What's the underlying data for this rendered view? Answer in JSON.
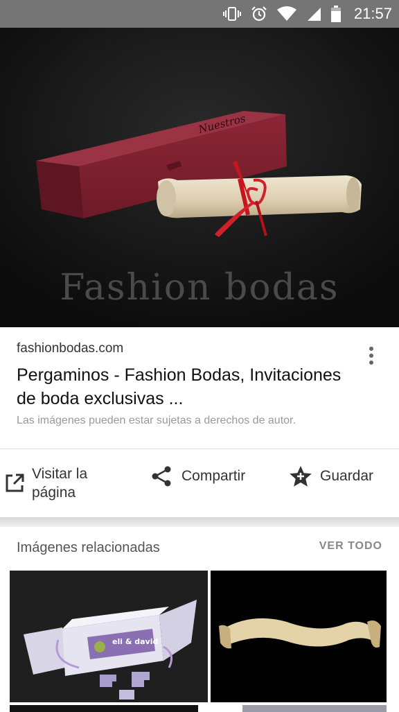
{
  "status_bar": {
    "time": "21:57",
    "icons": [
      "vibrate-icon",
      "alarm-icon",
      "wifi-icon",
      "signal-icon",
      "battery-icon"
    ]
  },
  "hero_image": {
    "watermark": "Fashion bodas",
    "box_script": "Nuestros"
  },
  "result": {
    "domain": "fashionbodas.com",
    "title": "Pergaminos - Fashion Bodas, Invitaciones de boda exclusivas ...",
    "copyright_notice": "Las imágenes pueden estar sujetas a derechos de autor."
  },
  "actions": {
    "visit_label": "Visitar la página",
    "share_label": "Compartir",
    "save_label": "Guardar"
  },
  "related": {
    "heading": "Imágenes relacionadas",
    "see_all": "VER TODO",
    "thumb1_text": "eli & david"
  },
  "colors": {
    "status_bar": "#757575",
    "box_red": "#7a1f2e",
    "ribbon": "#d0202a",
    "parchment": "#e4d8bf",
    "lilac": "#8a6fb3"
  }
}
